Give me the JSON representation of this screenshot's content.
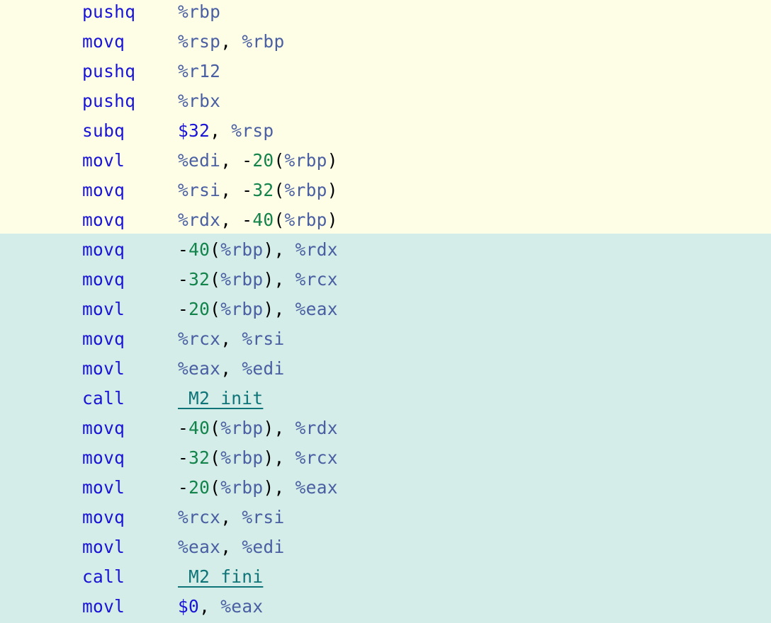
{
  "colors": {
    "prologue_background": "#fefee6",
    "body_background": "#d4ede8",
    "mnemonic": "#1a14d6",
    "register": "#4a5fa2",
    "number": "#12834a",
    "immediate": "#1a14d6",
    "punctuation": "#000000",
    "symbol_link": "#0f7478"
  },
  "blocks": [
    {
      "background": "#fefee6",
      "lines": [
        {
          "mnemonic": "pushq",
          "operands": [
            {
              "t": "reg",
              "v": "%rbp"
            }
          ]
        },
        {
          "mnemonic": "movq",
          "operands": [
            {
              "t": "reg",
              "v": "%rsp"
            },
            {
              "t": "p",
              "v": ", "
            },
            {
              "t": "reg",
              "v": "%rbp"
            }
          ]
        },
        {
          "mnemonic": "pushq",
          "operands": [
            {
              "t": "reg",
              "v": "%r12"
            }
          ]
        },
        {
          "mnemonic": "pushq",
          "operands": [
            {
              "t": "reg",
              "v": "%rbx"
            }
          ]
        },
        {
          "mnemonic": "subq",
          "operands": [
            {
              "t": "imm",
              "v": "$32"
            },
            {
              "t": "p",
              "v": ", "
            },
            {
              "t": "reg",
              "v": "%rsp"
            }
          ]
        },
        {
          "mnemonic": "movl",
          "operands": [
            {
              "t": "reg",
              "v": "%edi"
            },
            {
              "t": "p",
              "v": ", -"
            },
            {
              "t": "num",
              "v": "20"
            },
            {
              "t": "p",
              "v": "("
            },
            {
              "t": "reg",
              "v": "%rbp"
            },
            {
              "t": "p",
              "v": ")"
            }
          ]
        },
        {
          "mnemonic": "movq",
          "operands": [
            {
              "t": "reg",
              "v": "%rsi"
            },
            {
              "t": "p",
              "v": ", -"
            },
            {
              "t": "num",
              "v": "32"
            },
            {
              "t": "p",
              "v": "("
            },
            {
              "t": "reg",
              "v": "%rbp"
            },
            {
              "t": "p",
              "v": ")"
            }
          ]
        },
        {
          "mnemonic": "movq",
          "operands": [
            {
              "t": "reg",
              "v": "%rdx"
            },
            {
              "t": "p",
              "v": ", -"
            },
            {
              "t": "num",
              "v": "40"
            },
            {
              "t": "p",
              "v": "("
            },
            {
              "t": "reg",
              "v": "%rbp"
            },
            {
              "t": "p",
              "v": ")"
            }
          ]
        }
      ]
    },
    {
      "background": "#d4ede8",
      "lines": [
        {
          "mnemonic": "movq",
          "operands": [
            {
              "t": "p",
              "v": "-"
            },
            {
              "t": "num",
              "v": "40"
            },
            {
              "t": "p",
              "v": "("
            },
            {
              "t": "reg",
              "v": "%rbp"
            },
            {
              "t": "p",
              "v": "), "
            },
            {
              "t": "reg",
              "v": "%rdx"
            }
          ]
        },
        {
          "mnemonic": "movq",
          "operands": [
            {
              "t": "p",
              "v": "-"
            },
            {
              "t": "num",
              "v": "32"
            },
            {
              "t": "p",
              "v": "("
            },
            {
              "t": "reg",
              "v": "%rbp"
            },
            {
              "t": "p",
              "v": "), "
            },
            {
              "t": "reg",
              "v": "%rcx"
            }
          ]
        },
        {
          "mnemonic": "movl",
          "operands": [
            {
              "t": "p",
              "v": "-"
            },
            {
              "t": "num",
              "v": "20"
            },
            {
              "t": "p",
              "v": "("
            },
            {
              "t": "reg",
              "v": "%rbp"
            },
            {
              "t": "p",
              "v": "), "
            },
            {
              "t": "reg",
              "v": "%eax"
            }
          ]
        },
        {
          "mnemonic": "movq",
          "operands": [
            {
              "t": "reg",
              "v": "%rcx"
            },
            {
              "t": "p",
              "v": ", "
            },
            {
              "t": "reg",
              "v": "%rsi"
            }
          ]
        },
        {
          "mnemonic": "movl",
          "operands": [
            {
              "t": "reg",
              "v": "%eax"
            },
            {
              "t": "p",
              "v": ", "
            },
            {
              "t": "reg",
              "v": "%edi"
            }
          ]
        },
        {
          "mnemonic": "call",
          "operands": [
            {
              "t": "sym",
              "v": "_M2_init"
            }
          ]
        },
        {
          "mnemonic": "movq",
          "operands": [
            {
              "t": "p",
              "v": "-"
            },
            {
              "t": "num",
              "v": "40"
            },
            {
              "t": "p",
              "v": "("
            },
            {
              "t": "reg",
              "v": "%rbp"
            },
            {
              "t": "p",
              "v": "), "
            },
            {
              "t": "reg",
              "v": "%rdx"
            }
          ]
        },
        {
          "mnemonic": "movq",
          "operands": [
            {
              "t": "p",
              "v": "-"
            },
            {
              "t": "num",
              "v": "32"
            },
            {
              "t": "p",
              "v": "("
            },
            {
              "t": "reg",
              "v": "%rbp"
            },
            {
              "t": "p",
              "v": "), "
            },
            {
              "t": "reg",
              "v": "%rcx"
            }
          ]
        },
        {
          "mnemonic": "movl",
          "operands": [
            {
              "t": "p",
              "v": "-"
            },
            {
              "t": "num",
              "v": "20"
            },
            {
              "t": "p",
              "v": "("
            },
            {
              "t": "reg",
              "v": "%rbp"
            },
            {
              "t": "p",
              "v": "), "
            },
            {
              "t": "reg",
              "v": "%eax"
            }
          ]
        },
        {
          "mnemonic": "movq",
          "operands": [
            {
              "t": "reg",
              "v": "%rcx"
            },
            {
              "t": "p",
              "v": ", "
            },
            {
              "t": "reg",
              "v": "%rsi"
            }
          ]
        },
        {
          "mnemonic": "movl",
          "operands": [
            {
              "t": "reg",
              "v": "%eax"
            },
            {
              "t": "p",
              "v": ", "
            },
            {
              "t": "reg",
              "v": "%edi"
            }
          ]
        },
        {
          "mnemonic": "call",
          "operands": [
            {
              "t": "sym",
              "v": "_M2_fini"
            }
          ]
        },
        {
          "mnemonic": "movl",
          "operands": [
            {
              "t": "imm",
              "v": "$0"
            },
            {
              "t": "p",
              "v": ", "
            },
            {
              "t": "reg",
              "v": "%eax"
            }
          ]
        }
      ]
    }
  ]
}
